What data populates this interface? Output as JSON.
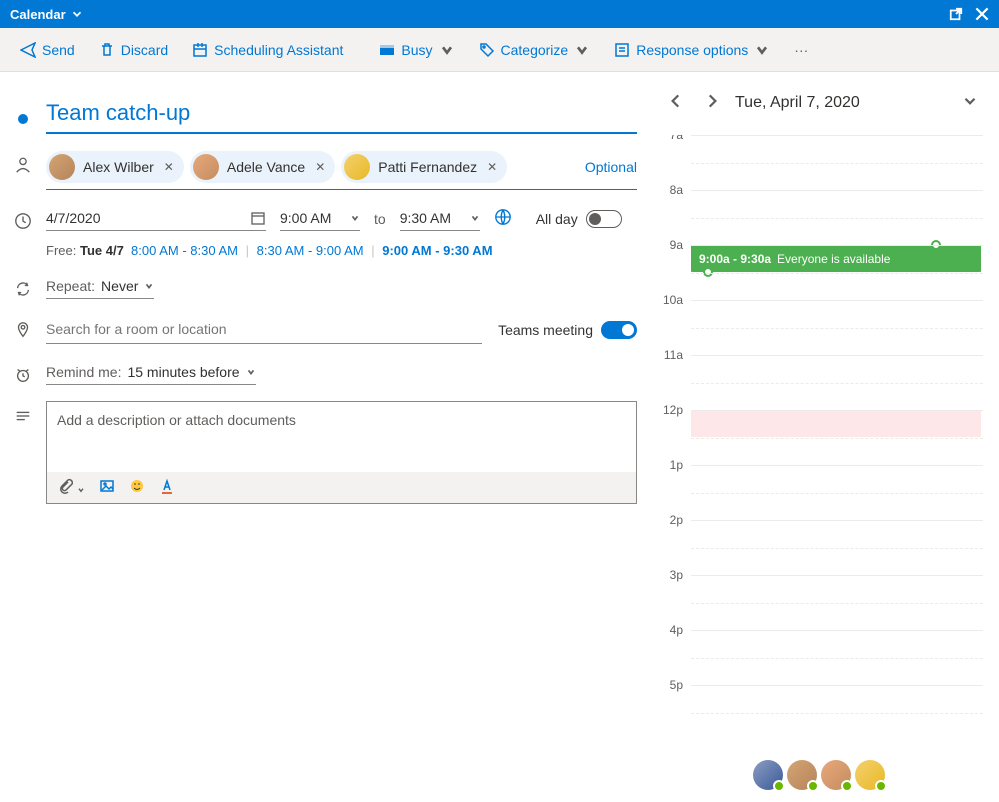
{
  "titlebar": {
    "title": "Calendar"
  },
  "toolbar": {
    "send": "Send",
    "discard": "Discard",
    "scheduling": "Scheduling Assistant",
    "busy": "Busy",
    "categorize": "Categorize",
    "response": "Response options"
  },
  "event": {
    "title": "Team catch-up",
    "attendees": [
      {
        "name": "Alex Wilber"
      },
      {
        "name": "Adele Vance"
      },
      {
        "name": "Patti Fernandez"
      }
    ],
    "optional_label": "Optional",
    "date": "4/7/2020",
    "start_time": "9:00 AM",
    "to": "to",
    "end_time": "9:30 AM",
    "all_day_label": "All day",
    "free_label": "Free:",
    "free_day": "Tue 4/7",
    "free_slots": [
      {
        "text": "8:00 AM - 8:30 AM",
        "bold": false
      },
      {
        "text": "8:30 AM - 9:00 AM",
        "bold": false
      },
      {
        "text": "9:00 AM - 9:30 AM",
        "bold": true
      }
    ],
    "repeat_label": "Repeat:",
    "repeat_value": "Never",
    "location_placeholder": "Search for a room or location",
    "teams_label": "Teams meeting",
    "remind_label": "Remind me:",
    "remind_value": "15 minutes before",
    "description_placeholder": "Add a description or attach documents"
  },
  "calendar": {
    "date_display": "Tue, April 7, 2020",
    "hours": [
      "7a",
      "8a",
      "9a",
      "10a",
      "11a",
      "12p",
      "1p",
      "2p",
      "3p",
      "4p",
      "5p"
    ],
    "event_time": "9:00a - 9:30a",
    "event_text": "Everyone is available"
  }
}
